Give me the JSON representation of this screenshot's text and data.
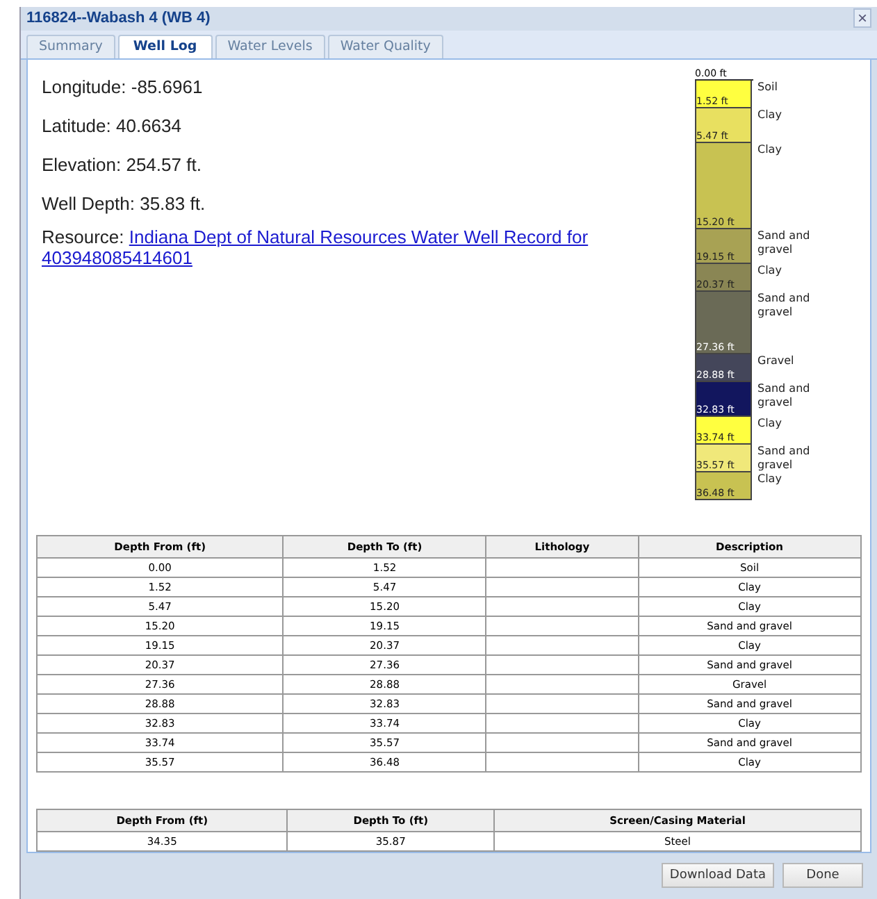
{
  "window": {
    "title": "116824--Wabash 4 (WB 4)",
    "close": "×"
  },
  "tabs": [
    {
      "label": "Summary",
      "selected": false
    },
    {
      "label": "Well Log",
      "selected": true
    },
    {
      "label": "Water Levels",
      "selected": false
    },
    {
      "label": "Water Quality",
      "selected": false
    }
  ],
  "info": [
    {
      "label": "Longitude:",
      "value": "-85.6961"
    },
    {
      "label": "Latitude:",
      "value": "40.6634"
    },
    {
      "label": "Elevation:",
      "value": "254.57 ft."
    },
    {
      "label": "Well Depth:",
      "value": "35.83 ft."
    }
  ],
  "resource": {
    "label": "Resource:",
    "link_lines": [
      "Indiana Dept of Natural Resources Water Well Record for",
      "403948085414601"
    ]
  },
  "log": {
    "top": "0.00 ft",
    "layers": [
      {
        "bottom": "1.52 ft",
        "description": "Soil",
        "color": "#ffff40"
      },
      {
        "bottom": "5.47 ft",
        "description": "Clay",
        "color": "#e8e060"
      },
      {
        "bottom": "15.20 ft",
        "description": "Clay",
        "color": "#c8c252"
      },
      {
        "bottom": "19.15 ft",
        "description": "Sand and gravel",
        "color": "#a8a254"
      },
      {
        "bottom": "20.37 ft",
        "description": "Clay",
        "color": "#8a8654"
      },
      {
        "bottom": "27.36 ft",
        "description": "Sand and gravel",
        "color": "#6a6a56"
      },
      {
        "bottom": "28.88 ft",
        "description": "Gravel",
        "color": "#44465a"
      },
      {
        "bottom": "32.83 ft",
        "description": "Sand and gravel",
        "color": "#12165e"
      },
      {
        "bottom": "33.74 ft",
        "description": "Clay",
        "color": "#ffff40"
      },
      {
        "bottom": "35.57 ft",
        "description": "Sand and gravel",
        "color": "#f0e87a"
      },
      {
        "bottom": "36.48 ft",
        "description": "Clay",
        "color": "#c8c252"
      }
    ]
  },
  "lithology_table": {
    "columns": [
      "Depth From (ft)",
      "Depth To (ft)",
      "Lithology",
      "Description"
    ],
    "rows": [
      [
        "0.00",
        "1.52",
        "",
        "Soil"
      ],
      [
        "1.52",
        "5.47",
        "",
        "Clay"
      ],
      [
        "5.47",
        "15.20",
        "",
        "Clay"
      ],
      [
        "15.20",
        "19.15",
        "",
        "Sand and gravel"
      ],
      [
        "19.15",
        "20.37",
        "",
        "Clay"
      ],
      [
        "20.37",
        "27.36",
        "",
        "Sand and gravel"
      ],
      [
        "27.36",
        "28.88",
        "",
        "Gravel"
      ],
      [
        "28.88",
        "32.83",
        "",
        "Sand and gravel"
      ],
      [
        "32.83",
        "33.74",
        "",
        "Clay"
      ],
      [
        "33.74",
        "35.57",
        "",
        "Sand and gravel"
      ],
      [
        "35.57",
        "36.48",
        "",
        "Clay"
      ]
    ]
  },
  "casing_table": {
    "columns": [
      "Depth From (ft)",
      "Depth To (ft)",
      "Screen/Casing Material"
    ],
    "rows": [
      [
        "34.35",
        "35.87",
        "Steel"
      ]
    ]
  },
  "buttons": [
    "Download Data",
    "Done"
  ]
}
